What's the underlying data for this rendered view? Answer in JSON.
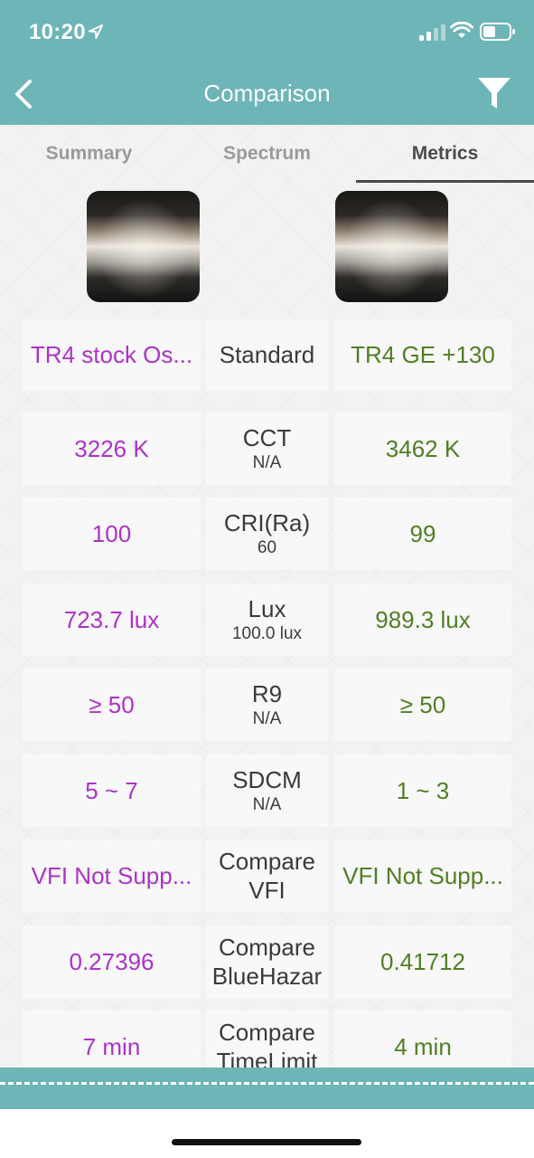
{
  "status": {
    "time": "10:20"
  },
  "nav": {
    "title": "Comparison"
  },
  "tabs": [
    {
      "label": "Summary",
      "active": false
    },
    {
      "label": "Spectrum",
      "active": false
    },
    {
      "label": "Metrics",
      "active": true
    }
  ],
  "colors": {
    "header": "#6db5b6",
    "left_value": "#ac32c9",
    "right_value": "#4f7f24"
  },
  "names": {
    "left": "TR4 stock Os...",
    "middle": "Standard",
    "right": "TR4 GE +130"
  },
  "rows": [
    {
      "left": "3226 K",
      "label": "CCT",
      "sub": "N/A",
      "right": "3462 K"
    },
    {
      "left": "100",
      "label": "CRI(Ra)",
      "sub": "60",
      "right": "99"
    },
    {
      "left": "723.7 lux",
      "label": "Lux",
      "sub": "100.0 lux",
      "right": "989.3 lux"
    },
    {
      "left": "≥ 50",
      "label": "R9",
      "sub": "N/A",
      "right": "≥ 50"
    },
    {
      "left": "5 ~ 7",
      "label": "SDCM",
      "sub": "N/A",
      "right": "1 ~ 3"
    },
    {
      "left": "VFI Not Supp...",
      "label": "Compare",
      "sub": "VFI",
      "right": "VFI Not Supp..."
    },
    {
      "left": "0.27396",
      "label": "Compare",
      "sub": "BlueHazar",
      "right": "0.41712"
    },
    {
      "left": "7 min",
      "label": "Compare",
      "sub": "TimeLimit",
      "right": "4 min"
    }
  ]
}
